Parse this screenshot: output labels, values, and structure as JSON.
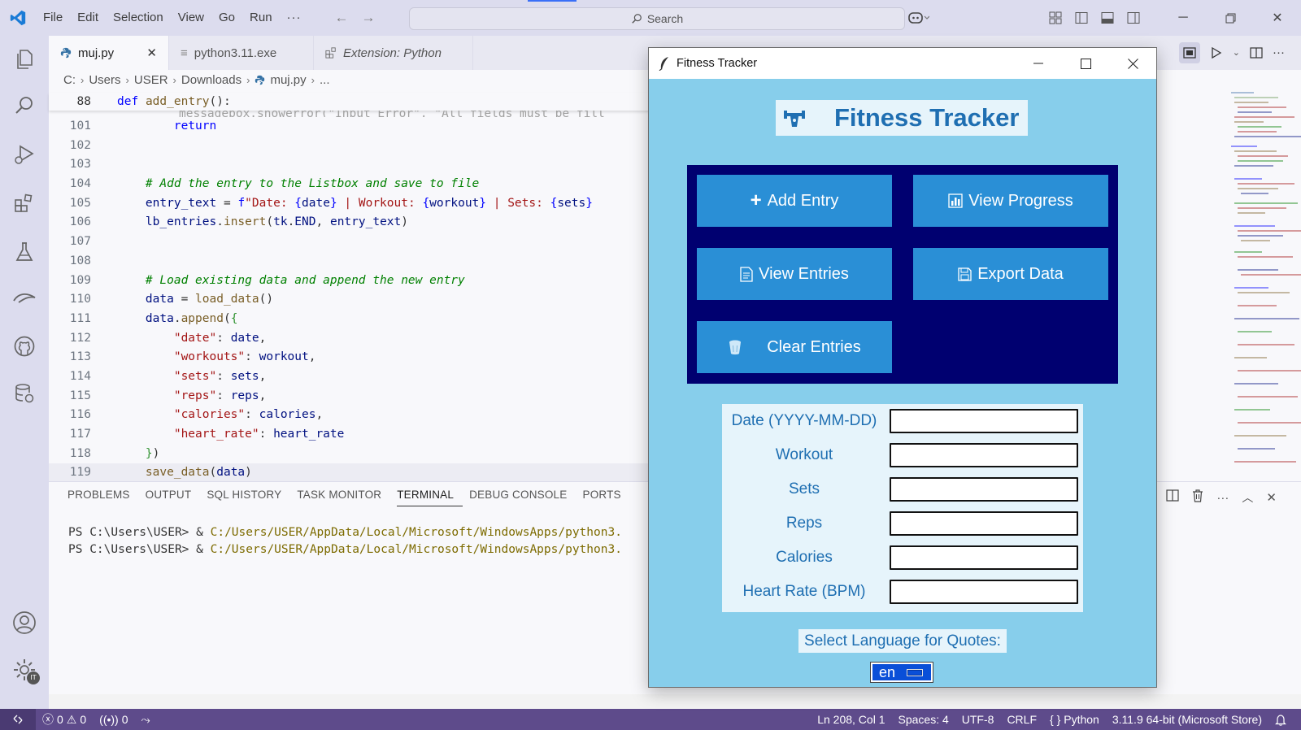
{
  "titlebar": {
    "menu": [
      "File",
      "Edit",
      "Selection",
      "View",
      "Go",
      "Run",
      "···"
    ],
    "search_placeholder": "Search"
  },
  "tabs": [
    {
      "label": "muj.py",
      "icon": "python-icon",
      "active": true
    },
    {
      "label": "python3.11.exe",
      "icon": "file-icon",
      "active": false
    },
    {
      "label": "Extension: Python",
      "icon": "extensions-icon",
      "active": false,
      "italic": true
    }
  ],
  "breadcrumb": [
    "C:",
    "Users",
    "USER",
    "Downloads",
    "muj.py",
    "..."
  ],
  "code": {
    "sticky_line_number": "88",
    "sticky_text": "def add_entry():",
    "hidden_text": "messagebox.showerror(\"Input Error\", \"All fields must be fill",
    "lines": [
      {
        "n": "101",
        "text": "        return"
      },
      {
        "n": "102",
        "text": ""
      },
      {
        "n": "103",
        "text": ""
      },
      {
        "n": "104",
        "text": "    # Add the entry to the Listbox and save to file"
      },
      {
        "n": "105",
        "text": "    entry_text = f\"Date: {date} | Workout: {workout} | Sets: {sets}"
      },
      {
        "n": "106",
        "text": "    lb_entries.insert(tk.END, entry_text)"
      },
      {
        "n": "107",
        "text": ""
      },
      {
        "n": "108",
        "text": ""
      },
      {
        "n": "109",
        "text": "    # Load existing data and append the new entry"
      },
      {
        "n": "110",
        "text": "    data = load_data()"
      },
      {
        "n": "111",
        "text": "    data.append({"
      },
      {
        "n": "112",
        "text": "        \"date\": date,"
      },
      {
        "n": "113",
        "text": "        \"workouts\": workout,"
      },
      {
        "n": "114",
        "text": "        \"sets\": sets,"
      },
      {
        "n": "115",
        "text": "        \"reps\": reps,"
      },
      {
        "n": "116",
        "text": "        \"calories\": calories,"
      },
      {
        "n": "117",
        "text": "        \"heart_rate\": heart_rate"
      },
      {
        "n": "118",
        "text": "    })"
      },
      {
        "n": "119",
        "text": "    save_data(data)"
      }
    ]
  },
  "panel": {
    "tabs": [
      "PROBLEMS",
      "OUTPUT",
      "SQL HISTORY",
      "TASK MONITOR",
      "TERMINAL",
      "DEBUG CONSOLE",
      "PORTS"
    ],
    "active_tab": "TERMINAL",
    "terminal_lines": [
      {
        "prompt": "PS C:\\Users\\USER> & ",
        "path": "C:/Users/USER/AppData/Local/Microsoft/WindowsApps/python3."
      },
      {
        "prompt": "PS C:\\Users\\USER> & ",
        "path": "C:/Users/USER/AppData/Local/Microsoft/WindowsApps/python3."
      }
    ]
  },
  "statusbar": {
    "errors": "0",
    "warnings": "0",
    "ports": "0",
    "position": "Ln 208, Col 1",
    "spaces": "Spaces: 4",
    "encoding": "UTF-8",
    "eol": "CRLF",
    "language": "Python",
    "interpreter": "3.11.9 64-bit (Microsoft Store)"
  },
  "fitness_app": {
    "window_title": "Fitness Tracker",
    "header_title": "Fitness Tracker",
    "buttons": {
      "add_entry": "Add Entry",
      "view_progress": "View Progress",
      "view_entries": "View Entries",
      "export_data": "Export Data",
      "clear_entries": "Clear Entries"
    },
    "form_fields": [
      {
        "label": "Date (YYYY-MM-DD)",
        "value": ""
      },
      {
        "label": "Workout",
        "value": ""
      },
      {
        "label": "Sets",
        "value": ""
      },
      {
        "label": "Reps",
        "value": ""
      },
      {
        "label": "Calories",
        "value": ""
      },
      {
        "label": "Heart Rate (BPM)",
        "value": ""
      }
    ],
    "language_label": "Select Language for Quotes:",
    "language_value": "en",
    "colors": {
      "background": "#87ceeb",
      "button_panel": "#000070",
      "button": "#2a8fd6",
      "label_text": "#1f6fb2"
    }
  },
  "colors": {
    "statusbar": "#5e4b8b",
    "titlebar": "#dcdcee"
  }
}
